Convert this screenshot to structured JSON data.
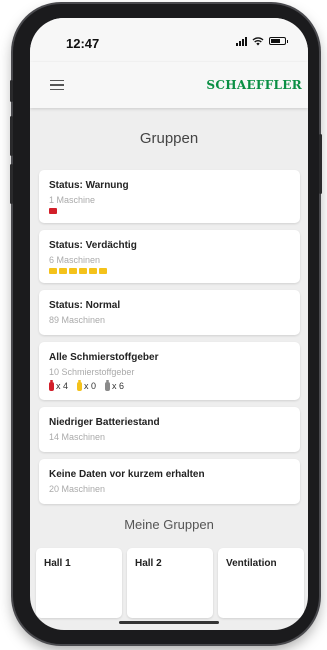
{
  "status_bar": {
    "time": "12:47",
    "icons": [
      "signal-icon",
      "wifi-icon",
      "battery-icon"
    ]
  },
  "app_bar": {
    "menu_icon": "hamburger-icon",
    "logo": "SCHAEFFLER"
  },
  "page": {
    "title": "Gruppen"
  },
  "cards": [
    {
      "title": "Status: Warnung",
      "subtitle": "1 Maschine",
      "icon_color": "#d21f2a"
    },
    {
      "title": "Status: Verdächtig",
      "subtitle": "6 Maschinen",
      "icon_color": "#f4c21a"
    },
    {
      "title": "Status: Normal",
      "subtitle": "89 Maschinen"
    },
    {
      "title": "Alle Schmierstoffgeber",
      "subtitle": "10 Schmierstoffgeber",
      "lubricators": [
        {
          "color": "#d21f2a",
          "count": "x 4"
        },
        {
          "color": "#f4c21a",
          "count": "x 0"
        },
        {
          "color": "#8a8a8a",
          "count": "x 6"
        }
      ]
    },
    {
      "title": "Niedriger Batteriestand",
      "subtitle": "14 Maschinen"
    },
    {
      "title": "Keine Daten vor kurzem erhalten",
      "subtitle": "20 Maschinen"
    }
  ],
  "my_groups": {
    "title": "Meine Gruppen",
    "items": [
      {
        "label": "Hall 1"
      },
      {
        "label": "Hall 2"
      },
      {
        "label": "Ventilation"
      }
    ]
  },
  "colors": {
    "brand": "#0a8f44",
    "warning": "#d21f2a",
    "suspect": "#f4c21a"
  }
}
